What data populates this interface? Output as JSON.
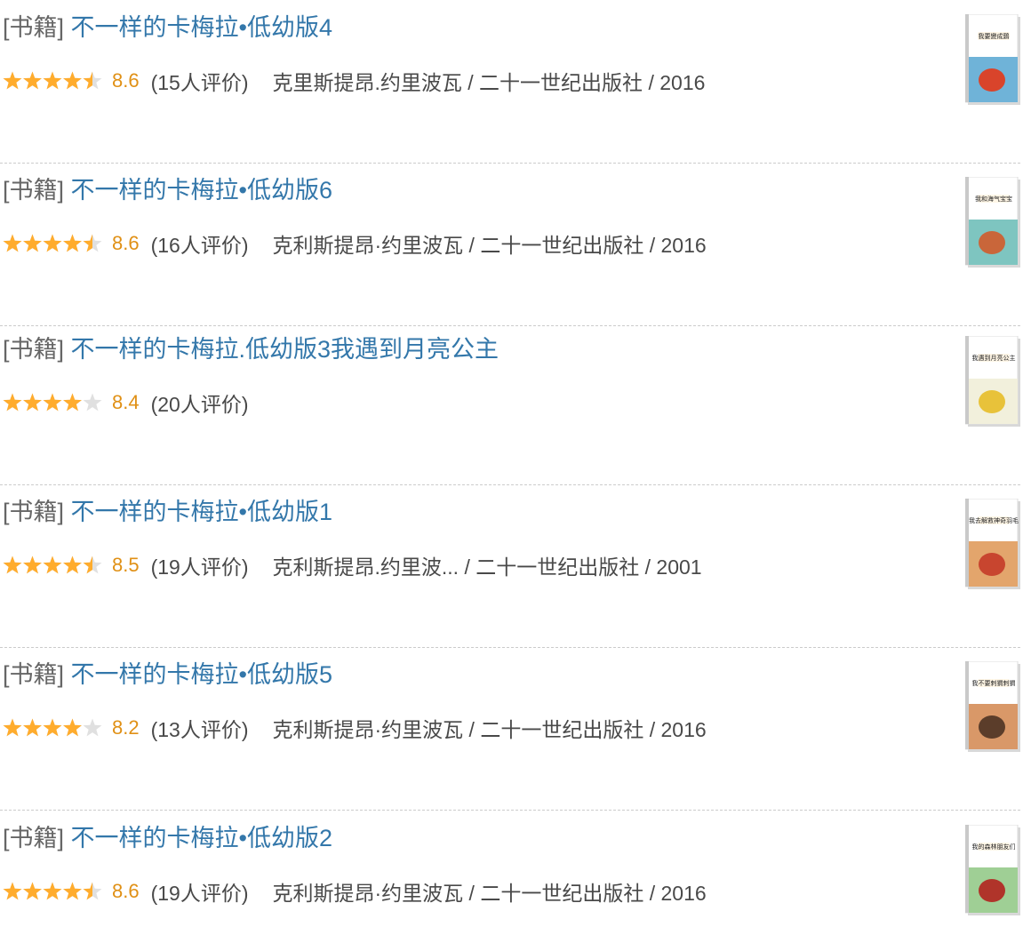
{
  "colors": {
    "link": "#3377aa",
    "rating": "#e09015",
    "star_full": "#ffac2d",
    "star_empty": "#e0e0e0",
    "divider": "#cccccc"
  },
  "items": [
    {
      "tag": "[书籍]",
      "title": "不一样的卡梅拉•低幼版4",
      "stars": 4.5,
      "rating": "8.6",
      "count": "(15人评价)",
      "pub": "克里斯提昂.约里波瓦 / 二十一世纪出版社 / 2016",
      "cover": {
        "title": "我要變成鷄",
        "bg": "#6fb3d8",
        "accent": "#d9442b"
      }
    },
    {
      "tag": "[书籍]",
      "title": "不一样的卡梅拉•低幼版6",
      "stars": 4.5,
      "rating": "8.6",
      "count": "(16人评价)",
      "pub": "克利斯提昂·约里波瓦 / 二十一世纪出版社 / 2016",
      "cover": {
        "title": "我和海气宝宝",
        "bg": "#7ec5c0",
        "accent": "#c9663a"
      }
    },
    {
      "tag": "[书籍]",
      "title": "不一样的卡梅拉.低幼版3我遇到月亮公主",
      "stars": 4,
      "rating": "8.4",
      "count": "(20人评价)",
      "pub": "",
      "cover": {
        "title": "我遇到月亮公主",
        "bg": "#f2f0dc",
        "accent": "#e8c23a"
      }
    },
    {
      "tag": "[书籍]",
      "title": "不一样的卡梅拉•低幼版1",
      "stars": 4.5,
      "rating": "8.5",
      "count": "(19人评价)",
      "pub": "克利斯提昂.约里波... / 二十一世纪出版社 / 2001",
      "cover": {
        "title": "我去解救神奇羽毛",
        "bg": "#e3a56c",
        "accent": "#c8452f"
      }
    },
    {
      "tag": "[书籍]",
      "title": "不一样的卡梅拉•低幼版5",
      "stars": 4,
      "rating": "8.2",
      "count": "(13人评价)",
      "pub": "克利斯提昂·约里波瓦 / 二十一世纪出版社 / 2016",
      "cover": {
        "title": "我不要刺猬刺猬",
        "bg": "#d99868",
        "accent": "#5b3d2a"
      }
    },
    {
      "tag": "[书籍]",
      "title": "不一样的卡梅拉•低幼版2",
      "stars": 4.5,
      "rating": "8.6",
      "count": "(19人评价)",
      "pub": "克利斯提昂·约里波瓦 / 二十一世纪出版社 / 2016",
      "cover": {
        "title": "我的森林朋友们",
        "bg": "#9fcf95",
        "accent": "#b0342a"
      }
    }
  ]
}
